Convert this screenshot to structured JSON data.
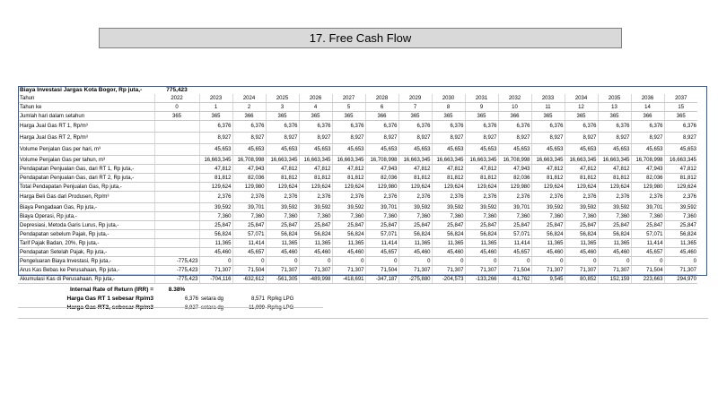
{
  "slide": {
    "title": "17.  Free Cash Flow"
  },
  "investment": {
    "label": "Biaya Investasi Jargas Kota Bogor, Rp juta,-",
    "value": "775,423"
  },
  "years": [
    "2022",
    "2023",
    "2024",
    "2025",
    "2026",
    "2027",
    "2028",
    "2029",
    "2030",
    "2031",
    "2032",
    "2033",
    "2034",
    "2035",
    "2036",
    "2037"
  ],
  "year_index": [
    "0",
    "1",
    "2",
    "3",
    "4",
    "5",
    "6",
    "7",
    "8",
    "9",
    "10",
    "11",
    "12",
    "13",
    "14",
    "15"
  ],
  "rows": [
    {
      "label": "Tahun",
      "values": [
        "2022",
        "2023",
        "2024",
        "2025",
        "2026",
        "2027",
        "2028",
        "2029",
        "2030",
        "2031",
        "2032",
        "2033",
        "2034",
        "2035",
        "2036",
        "2037"
      ],
      "align": "ctr"
    },
    {
      "label": "Tahun ke",
      "values": [
        "0",
        "1",
        "2",
        "3",
        "4",
        "5",
        "6",
        "7",
        "8",
        "9",
        "10",
        "11",
        "12",
        "13",
        "14",
        "15"
      ],
      "align": "ctr"
    },
    {
      "label": "Jumlah hari dalam setahun",
      "values": [
        "365",
        "365",
        "366",
        "365",
        "365",
        "365",
        "366",
        "365",
        "365",
        "365",
        "366",
        "365",
        "365",
        "365",
        "366",
        "365"
      ],
      "align": "ctr"
    },
    {
      "label": "Harga Jual Gas RT 1, Rp/m³",
      "values": [
        "",
        "6,376",
        "6,376",
        "6,376",
        "6,376",
        "6,376",
        "6,376",
        "6,376",
        "6,376",
        "6,376",
        "6,376",
        "6,376",
        "6,376",
        "6,376",
        "6,376",
        "6,376"
      ],
      "align": "num",
      "tall": true
    },
    {
      "label": "Harga Jual Gas RT 2, Rp/m³",
      "values": [
        "",
        "8,927",
        "8,927",
        "8,927",
        "8,927",
        "8,927",
        "8,927",
        "8,927",
        "8,927",
        "8,927",
        "8,927",
        "8,927",
        "8,927",
        "8,927",
        "8,927",
        "8,927"
      ],
      "align": "num",
      "tall": true
    },
    {
      "label": "Volume Penjalan Gas per hari, m³",
      "values": [
        "",
        "45,653",
        "45,653",
        "45,653",
        "45,653",
        "45,653",
        "45,653",
        "45,653",
        "45,653",
        "45,653",
        "45,653",
        "45,653",
        "45,653",
        "45,653",
        "45,653",
        "45,653"
      ],
      "align": "num",
      "tall": true
    },
    {
      "label": "Volume Penjalan Gas per tahun, m³",
      "values": [
        "",
        "16,663,345",
        "16,708,998",
        "16,663,345",
        "16,663,345",
        "16,663,345",
        "16,708,998",
        "16,663,345",
        "16,663,345",
        "16,663,345",
        "16,708,998",
        "16,663,345",
        "16,663,345",
        "16,663,345",
        "16,708,998",
        "16,663,345"
      ],
      "align": "num"
    },
    {
      "label": "Pendapatan Penjualan Gas, dari RT 1, Rp juta,-",
      "values": [
        "",
        "47,812",
        "47,943",
        "47,812",
        "47,812",
        "47,812",
        "47,943",
        "47,812",
        "47,812",
        "47,812",
        "47,943",
        "47,812",
        "47,812",
        "47,812",
        "47,943",
        "47,812"
      ],
      "align": "num"
    },
    {
      "label": "Pendapatan Penjualan Gas, dari RT 2, Rp juta,-",
      "values": [
        "",
        "81,812",
        "82,036",
        "81,812",
        "81,812",
        "81,812",
        "82,036",
        "81,812",
        "81,812",
        "81,812",
        "82,036",
        "81,812",
        "81,812",
        "81,812",
        "82,036",
        "81,812"
      ],
      "align": "num"
    },
    {
      "label": "Total Pendapatan Penjualan Gas, Rp juta,-",
      "values": [
        "",
        "129,624",
        "129,980",
        "129,624",
        "129,624",
        "129,624",
        "129,980",
        "129,624",
        "129,624",
        "129,624",
        "129,980",
        "129,624",
        "129,624",
        "129,624",
        "129,980",
        "129,624"
      ],
      "align": "num"
    },
    {
      "label": "Harga Beli  Gas dari Produsen, Rp/m³",
      "values": [
        "",
        "2,376",
        "2,376",
        "2,376",
        "2,376",
        "2,376",
        "2,376",
        "2,376",
        "2,376",
        "2,376",
        "2,376",
        "2,376",
        "2,376",
        "2,376",
        "2,376",
        "2,376"
      ],
      "align": "num",
      "tall": true
    },
    {
      "label": "Biaya Pengadaan Gas, Rp juta,-",
      "values": [
        "",
        "39,592",
        "39,701",
        "39,592",
        "39,592",
        "39,592",
        "39,701",
        "39,592",
        "39,592",
        "39,592",
        "39,701",
        "39,592",
        "39,592",
        "39,592",
        "39,701",
        "39,592"
      ],
      "align": "num"
    },
    {
      "label": "Biaya Operasi, Rp juta,-",
      "values": [
        "",
        "7,360",
        "7,360",
        "7,360",
        "7,360",
        "7,360",
        "7,360",
        "7,360",
        "7,360",
        "7,360",
        "7,360",
        "7,360",
        "7,360",
        "7,360",
        "7,360",
        "7,360"
      ],
      "align": "num"
    },
    {
      "label": "Depresiasi, Metoda Garis Lurus, Rp juta,-",
      "values": [
        "",
        "25,847",
        "25,847",
        "25,847",
        "25,847",
        "25,847",
        "25,847",
        "25,847",
        "25,847",
        "25,847",
        "25,847",
        "25,847",
        "25,847",
        "25,847",
        "25,847",
        "25,847"
      ],
      "align": "num"
    },
    {
      "label": "Pendapatan sebelum Pajak, Rp juta,-",
      "values": [
        "",
        "56,824",
        "57,071",
        "56,824",
        "56,824",
        "56,824",
        "57,071",
        "56,824",
        "56,824",
        "56,824",
        "57,071",
        "56,824",
        "56,824",
        "56,824",
        "57,071",
        "56,824"
      ],
      "align": "num"
    },
    {
      "label": "Tarif Pajak Badan, 20%, Rp juta,-",
      "values": [
        "",
        "11,365",
        "11,414",
        "11,365",
        "11,365",
        "11,365",
        "11,414",
        "11,365",
        "11,365",
        "11,365",
        "11,414",
        "11,365",
        "11,365",
        "11,365",
        "11,414",
        "11,365"
      ],
      "align": "num"
    },
    {
      "label": "Pendapatan Setelah Pajak, Rp juta,-",
      "values": [
        "",
        "45,460",
        "45,657",
        "45,460",
        "45,460",
        "45,460",
        "45,657",
        "45,460",
        "45,460",
        "45,460",
        "45,657",
        "45,460",
        "45,460",
        "45,460",
        "45,657",
        "45,460"
      ],
      "align": "num"
    },
    {
      "label": "Pengeluaran Biaya Investasi, Rp juta,-",
      "values": [
        "-775,423",
        "0",
        "0",
        "0",
        "0",
        "0",
        "0",
        "0",
        "0",
        "0",
        "0",
        "0",
        "0",
        "0",
        "0",
        "0"
      ],
      "align": "num"
    },
    {
      "label": "Arus Kas Bebas ke Perusahaan, Rp juta,-",
      "values": [
        "-775,423",
        "71,307",
        "71,504",
        "71,307",
        "71,307",
        "71,307",
        "71,504",
        "71,307",
        "71,307",
        "71,307",
        "71,504",
        "71,307",
        "71,307",
        "71,307",
        "71,504",
        "71,307"
      ],
      "align": "num"
    },
    {
      "label": "Akumulasi Kas di Perusahaan, Rp juta,-",
      "values": [
        "-775,423",
        "-704,116",
        "-632,612",
        "-561,305",
        "-489,998",
        "-418,691",
        "-347,187",
        "-275,880",
        "-204,573",
        "-133,266",
        "-61,762",
        "9,545",
        "80,852",
        "152,159",
        "223,663",
        "294,970"
      ],
      "align": "num"
    }
  ],
  "summary": {
    "irr_label": "Internal Rate of Return (IRR) =",
    "irr_value": "8.38%",
    "rt1_label": "Harga Gas RT 1 sebesar Rp/m3",
    "rt1_value": "6,376",
    "rt1_eq": "setara dg",
    "rt1_lpg": "8,571",
    "rt1_unit": "Rp/kg LPG",
    "rt2_label": "Harga Gas RT2, sebesar Rp/m3",
    "rt2_value": "8,927",
    "rt2_eq": "setara dg",
    "rt2_lpg": "11,999",
    "rt2_unit": "Rp/kg LPG"
  }
}
